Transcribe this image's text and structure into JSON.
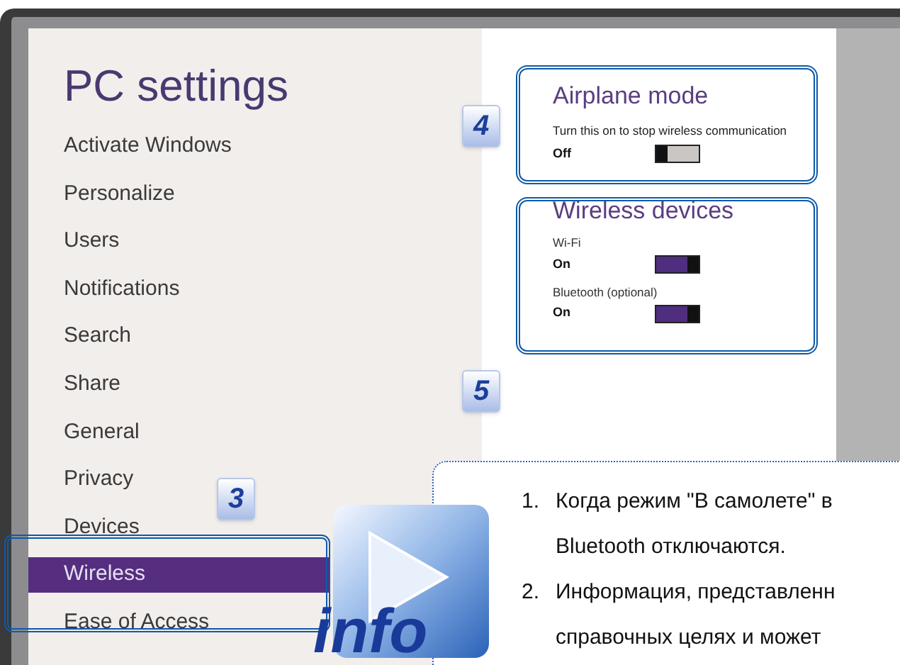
{
  "window": {
    "title": "PC settings"
  },
  "sidebar": {
    "items": [
      {
        "label": "Activate Windows",
        "selected": false
      },
      {
        "label": "Personalize",
        "selected": false
      },
      {
        "label": "Users",
        "selected": false
      },
      {
        "label": "Notifications",
        "selected": false
      },
      {
        "label": "Search",
        "selected": false
      },
      {
        "label": "Share",
        "selected": false
      },
      {
        "label": "General",
        "selected": false
      },
      {
        "label": "Privacy",
        "selected": false
      },
      {
        "label": "Devices",
        "selected": false
      },
      {
        "label": "Wireless",
        "selected": true
      },
      {
        "label": "Ease of Access",
        "selected": false
      }
    ]
  },
  "airplane_mode": {
    "title": "Airplane mode",
    "description": "Turn this on to stop wireless communication",
    "state": "Off",
    "on": false
  },
  "wireless_devices": {
    "title": "Wireless devices",
    "devices": [
      {
        "name": "Wi-Fi",
        "state": "On",
        "on": true
      },
      {
        "name": "Bluetooth (optional)",
        "state": "On",
        "on": true
      }
    ]
  },
  "callouts": [
    {
      "label": "4"
    },
    {
      "label": "5"
    },
    {
      "label": "3"
    }
  ],
  "info_badge": "info",
  "info_note": {
    "items": [
      {
        "number": "1.",
        "lines": [
          "Когда режим \"В самолете\" в",
          "Bluetooth отключаются."
        ]
      },
      {
        "number": "2.",
        "lines": [
          "Информация, представленн",
          "справочных целях и может"
        ]
      }
    ]
  }
}
